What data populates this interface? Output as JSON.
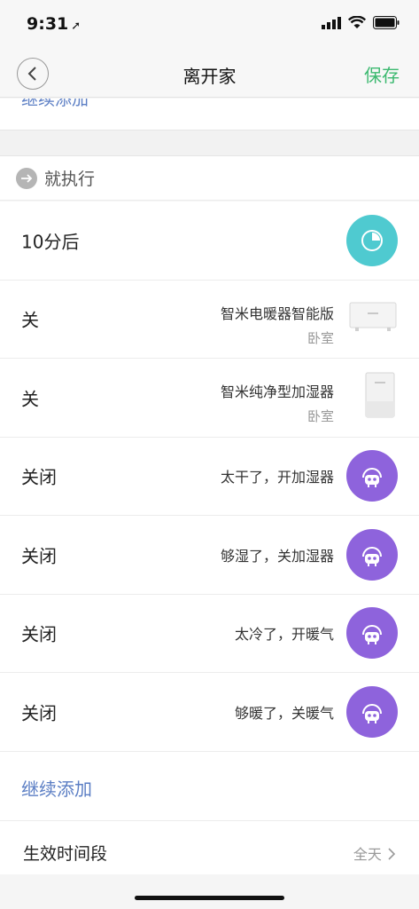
{
  "status_bar": {
    "time": "9:31"
  },
  "nav": {
    "title": "离开家",
    "save_label": "保存"
  },
  "top_add_label": "继续添加",
  "section": {
    "label": "就执行"
  },
  "rows": [
    {
      "action": "10分后",
      "kind": "timer"
    },
    {
      "action": "关",
      "device": "智米电暖器智能版",
      "room": "卧室",
      "kind": "device"
    },
    {
      "action": "关",
      "device": "智米纯净型加湿器",
      "room": "卧室",
      "kind": "device"
    },
    {
      "action": "关闭",
      "scene": "太干了，开加湿器",
      "kind": "scene"
    },
    {
      "action": "关闭",
      "scene": "够湿了，关加湿器",
      "kind": "scene"
    },
    {
      "action": "关闭",
      "scene": "太冷了，开暖气",
      "kind": "scene"
    },
    {
      "action": "关闭",
      "scene": "够暖了，关暖气",
      "kind": "scene"
    }
  ],
  "add_more_label": "继续添加",
  "effective_time": {
    "label": "生效时间段",
    "value": "全天"
  },
  "colors": {
    "accent_green": "#3cb970",
    "link_blue": "#5b7ec4",
    "timer_teal": "#4fcad0",
    "scene_purple": "#8e63dc"
  }
}
